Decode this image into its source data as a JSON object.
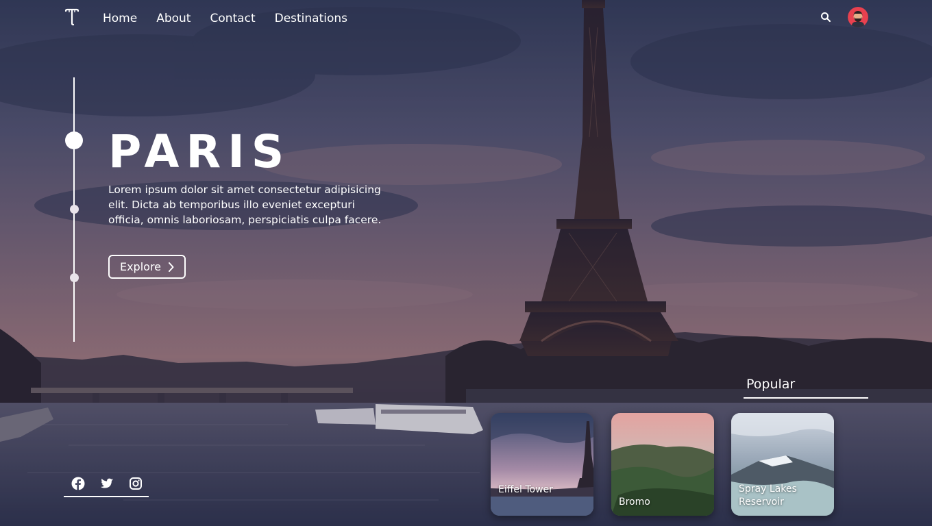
{
  "nav": {
    "logo_icon": "t-logo-icon",
    "links": [
      "Home",
      "About",
      "Contact",
      "Destinations"
    ],
    "search_icon": "search-icon",
    "avatar_icon": "user-avatar"
  },
  "hero": {
    "title": "PARIS",
    "description": "Lorem ipsum dolor sit amet consectetur adipisicing elit. Dicta ab temporibus illo eveniet excepturi officia, omnis laboriosam, perspiciatis culpa facere.",
    "button_label": "Explore",
    "button_icon": "chevron-right-icon",
    "slides": {
      "count": 3,
      "active": 1
    }
  },
  "popular": {
    "title": "Popular",
    "cards": [
      {
        "label": "Eiffel Tower"
      },
      {
        "label": "Bromo"
      },
      {
        "label": "Spray Lakes Reservoir"
      }
    ]
  },
  "social": {
    "icons": [
      "facebook-icon",
      "twitter-icon",
      "instagram-icon"
    ]
  },
  "colors": {
    "text": "#ffffff",
    "sky_top": "#3b4566",
    "sky_mid": "#7a6478",
    "horizon": "#a27c7e",
    "water": "#4a4d66"
  }
}
